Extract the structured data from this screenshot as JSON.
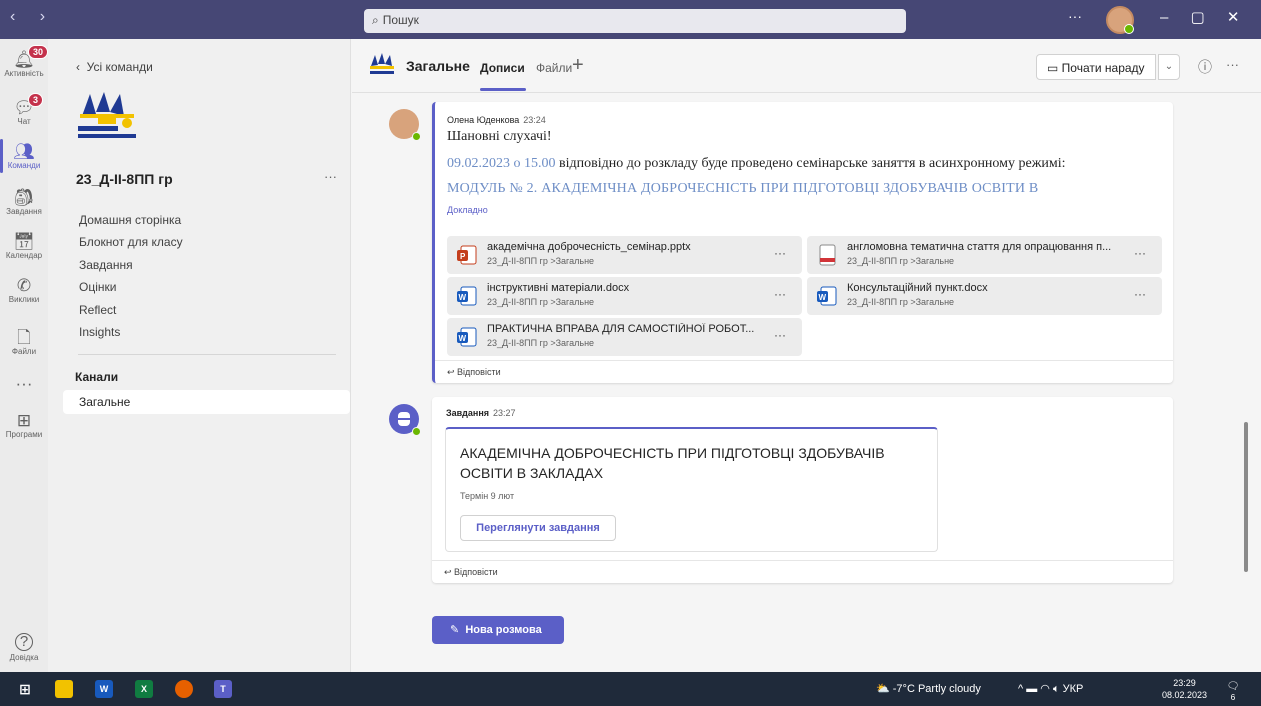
{
  "titlebar": {
    "search_placeholder": "Пошук",
    "more": "···"
  },
  "rail": {
    "activity": {
      "label": "Активність",
      "badge": "30"
    },
    "chat": {
      "label": "Чат",
      "badge": "3"
    },
    "teams": {
      "label": "Команди"
    },
    "assignments": {
      "label": "Завдання"
    },
    "calendar": {
      "label": "Календар"
    },
    "calls": {
      "label": "Виклики"
    },
    "files": {
      "label": "Файли"
    },
    "more": "···",
    "apps": {
      "label": "Програми"
    },
    "help": {
      "label": "Довідка"
    }
  },
  "sidebar": {
    "back": "Усі команди",
    "team_name": "23_Д-ІІ-8ПП гр",
    "team_more": "···",
    "links": [
      "Домашня сторінка",
      "Блокнот для класу",
      "Завдання",
      "Оцінки",
      "Reflect",
      "Insights"
    ],
    "channels_header": "Канали",
    "channels": [
      "Загальне"
    ]
  },
  "channel": {
    "title": "Загальне",
    "tabs": [
      "Дописи",
      "Файли"
    ],
    "meet_label": "Почати нараду"
  },
  "post1": {
    "author": "Олена Юденкова",
    "time": "23:24",
    "greeting": "Шановні слухачі!",
    "date_highlight": "09.02.2023  о 15.00",
    "date_rest": "  відповідно до розкладу буде проведено  семінарське заняття в асинхронному режимі:",
    "module": "МОДУЛЬ № 2.  АКАДЕМІЧНА  ДОБРОЧЕСНІСТЬ  ПРИ  ПІДГОТОВЦІ  ЗДОБУВАЧІВ  ОСВІТИ  В",
    "see_more": "Докладно",
    "files": [
      {
        "name": "академічна доброчесність_семінар.pptx",
        "path": "23_Д-ІІ-8ПП гр >Загальне",
        "icon": "powerpoint-icon"
      },
      {
        "name": "англомовна тематична стаття для опрацювання п...",
        "path": "23_Д-ІІ-8ПП гр >Загальне",
        "icon": "pdf-icon"
      },
      {
        "name": "інструктивні матеріали.docx",
        "path": "23_Д-ІІ-8ПП гр >Загальне",
        "icon": "word-icon"
      },
      {
        "name": "Консультаційний пункт.docx",
        "path": "23_Д-ІІ-8ПП гр >Загальне",
        "icon": "word-icon"
      },
      {
        "name": "ПРАКТИЧНА ВПРАВА ДЛЯ САМОСТІЙНОЇ РОБОТ...",
        "path": "23_Д-ІІ-8ПП гр >Загальне",
        "icon": "word-icon"
      }
    ],
    "reply": "Відповісти"
  },
  "post2": {
    "author": "Завдання",
    "time": "23:27",
    "card_title": "АКАДЕМІЧНА ДОБРОЧЕСНІСТЬ ПРИ ПІДГОТОВЦІ ЗДОБУВАЧІВ ОСВІТИ В ЗАКЛАДАХ",
    "due": "Термін 9 лют",
    "button": "Переглянути завдання",
    "reply": "Відповісти"
  },
  "new_conversation": "Нова розмова",
  "taskbar": {
    "weather": "-7°C  Partly cloudy",
    "lang": "УКР",
    "time": "23:29",
    "date": "08.02.2023",
    "notifications": "6"
  },
  "colors": {
    "accent": "#5b5fc7",
    "titlebar": "#464775",
    "link": "#6e8ec6"
  }
}
